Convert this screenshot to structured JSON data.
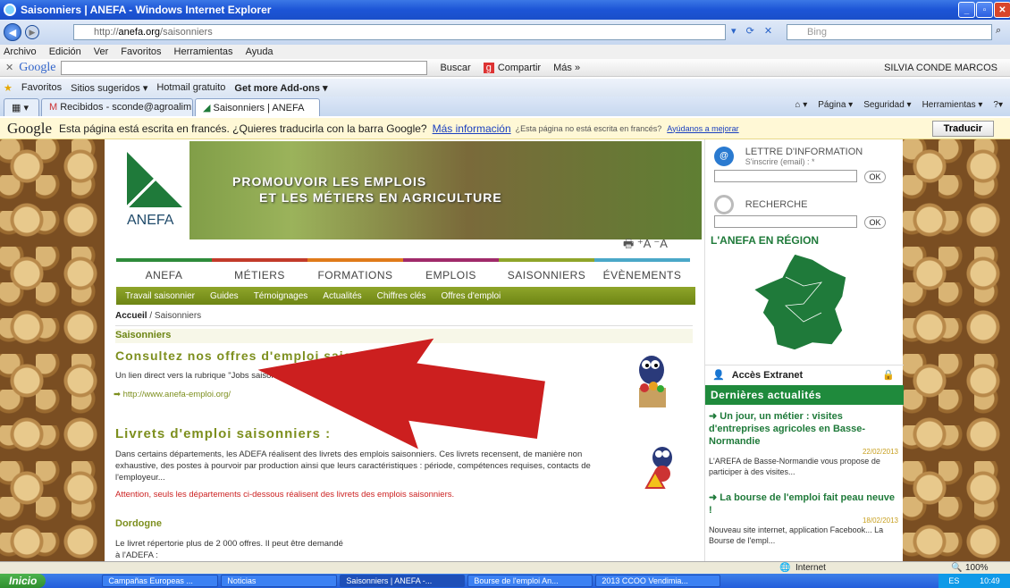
{
  "window": {
    "title": "Saisonniers | ANEFA - Windows Internet Explorer"
  },
  "address": {
    "prefix": "http://",
    "domain": "anefa.org",
    "path": "/saisonniers",
    "search_placeholder": "Bing"
  },
  "menu": [
    "Archivo",
    "Edición",
    "Ver",
    "Favoritos",
    "Herramientas",
    "Ayuda"
  ],
  "google_toolbar": {
    "logo": "Google",
    "buscar": "Buscar",
    "compartir": "Compartir",
    "mas": "Más »",
    "user": "SILVIA CONDE MARCOS"
  },
  "favorites": {
    "label": "Favoritos",
    "items": [
      "Sitios sugeridos ▾",
      "Hotmail gratuito",
      "Get more Add-ons ▾"
    ]
  },
  "tabs": [
    {
      "label": "Recibidos - sconde@agroalim..."
    },
    {
      "label": "Saisonniers | ANEFA"
    }
  ],
  "cmdbar": {
    "pagina": "Página ▾",
    "seguridad": "Seguridad ▾",
    "herramientas": "Herramientas ▾"
  },
  "translate": {
    "logo": "Google",
    "message": "Esta página está escrita en francés. ¿Quieres traducirla con la barra Google?",
    "link": "Más información",
    "small": "¿Esta página no está escrita en francés?",
    "small_link": "Ayúdanos a mejorar",
    "button": "Traducir"
  },
  "site": {
    "logo": "ANEFA",
    "banner_line1": "PROMOUVOIR LES EMPLOIS",
    "banner_line2": "ET LES MÉTIERS EN AGRICULTURE",
    "font_controls": "⁺A ⁻A",
    "nav": [
      {
        "label": "ANEFA",
        "color": "#2e8b3a"
      },
      {
        "label": "MÉTIERS",
        "color": "#c23a2a"
      },
      {
        "label": "FORMATIONS",
        "color": "#e07a1a"
      },
      {
        "label": "EMPLOIS",
        "color": "#a02a6a"
      },
      {
        "label": "SAISONNIERS",
        "color": "#8fa52a"
      },
      {
        "label": "ÉVÈNEMENTS",
        "color": "#4aa8c8"
      }
    ],
    "subnav": [
      "Travail saisonnier",
      "Guides",
      "Témoignages",
      "Actualités",
      "Chiffres clés",
      "Offres d'emploi"
    ],
    "breadcrumb_home": "Accueil",
    "breadcrumb_rest": " / Saisonniers",
    "section_title": "Saisonniers",
    "h_offres": "Consultez nos offres d'emploi saisonnier :",
    "p_offres": "Un lien direct vers la rubrique \"Jobs saisonniers\"",
    "link_offres": "➡  http://www.anefa-emploi.org/",
    "h_livrets": "Livrets d'emploi saisonniers :",
    "p_livrets": "Dans certains départements, les ADEFA réalisent des livrets des emplois saisonniers. Ces livrets recensent, de manière non exhaustive, des postes à pourvoir par production ainsi que leurs caractéristiques : période, compétences requises, contacts de l'employeur...",
    "warn": "Attention, seuls les départements ci-dessous réalisent des livrets des emplois saisonniers.",
    "h_dordogne": "Dordogne",
    "p_dordogne_1": "Le livret répertorie plus de 2 000 offres. Il peut être demandé",
    "p_dordogne_2": "à l'ADEFA :"
  },
  "sidebar": {
    "newsletter_title": "LETTRE D'INFORMATION",
    "newsletter_sub": "S'inscrire (email) : *",
    "ok": "OK",
    "search_title": "RECHERCHE",
    "region_title": "L'ANEFA EN RÉGION",
    "extranet": "Accès Extranet",
    "actu_title": "Dernières actualités",
    "news": [
      {
        "title": "➜ Un jour, un métier : visites d'entreprises agricoles en Basse-Normandie",
        "date": "22/02/2013",
        "text": "L'AREFA de Basse-Normandie vous propose de participer à des visites..."
      },
      {
        "title": "➜ La bourse de l'emploi fait peau neuve !",
        "date": "18/02/2013",
        "text": "Nouveau site internet, application Facebook... La Bourse de l'empl..."
      }
    ]
  },
  "status": {
    "zone": "Internet",
    "zoom": "100%"
  },
  "taskbar": {
    "start": "Inicio",
    "buttons": [
      "Campañas Europeas ...",
      "Noticias",
      "Saisonniers | ANEFA -...",
      "Bourse de l'emploi An...",
      "2013 CCOO Vendimia..."
    ],
    "lang": "ES",
    "time": "10:49"
  }
}
